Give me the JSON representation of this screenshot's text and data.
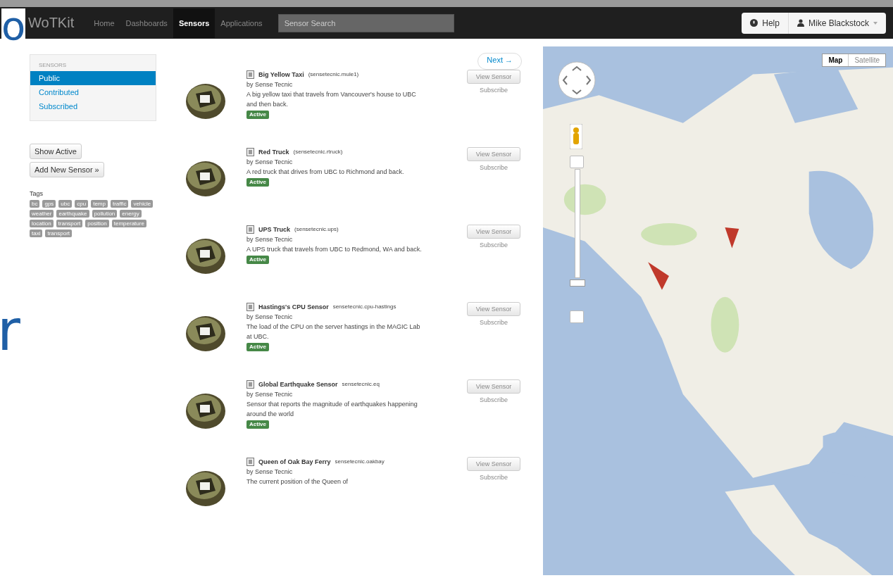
{
  "overlay_letters": [
    "o",
    "r"
  ],
  "navbar": {
    "brand": "WoTKit",
    "links": [
      {
        "label": "Home",
        "selected": false
      },
      {
        "label": "Dashboards",
        "selected": false
      },
      {
        "label": "Sensors",
        "selected": true
      },
      {
        "label": "Applications",
        "selected": false
      }
    ],
    "search": {
      "placeholder": "Sensor Search"
    },
    "help": "Help",
    "user": "Mike Blackstock"
  },
  "sidebar": {
    "heading": "SENSORS",
    "items": [
      {
        "label": "Public",
        "selected": true
      },
      {
        "label": "Contributed",
        "selected": false
      },
      {
        "label": "Subscribed",
        "selected": false
      }
    ],
    "buttons": [
      "Show Active",
      "Add New Sensor »"
    ],
    "tags_label": "Tags",
    "tags": [
      "bc",
      "gps",
      "ubc",
      "cpu",
      "temp",
      "traffic",
      "vehicle",
      "weather",
      "earthquake",
      "pollution",
      "energy",
      "location",
      "transport",
      "position",
      "temperature",
      "taxi",
      "transport"
    ]
  },
  "pager": {
    "next": "Next →"
  },
  "sensors": [
    {
      "title": "Big Yellow Taxi",
      "id": "(sensetecnic.mule1)",
      "byline": "by Sense Tecnic",
      "description": "A big yellow taxi that travels from Vancouver's house to UBC and then back.",
      "active": true,
      "status": "Active",
      "view": "View Sensor",
      "subscribe": "Subscribe"
    },
    {
      "title": "Red Truck",
      "id": "(sensetecnic.rtruck)",
      "byline": "by Sense Tecnic",
      "description": "A red truck that drives from UBC to Richmond and back.",
      "active": true,
      "status": "Active",
      "view": "View Sensor",
      "subscribe": "Subscribe"
    },
    {
      "title": "UPS Truck",
      "id": "(sensetecnic.ups)",
      "byline": "by Sense Tecnic",
      "description": "A UPS truck that travels from UBC to Redmond, WA and back.",
      "active": true,
      "status": "Active",
      "view": "View Sensor",
      "subscribe": "Subscribe"
    },
    {
      "title": "Hastings's CPU Sensor",
      "id": "sensetecnic.cpu-hastings",
      "byline": "by Sense Tecnic",
      "description": "The load of the CPU on the server hastings in the MAGIC Lab at UBC.",
      "active": true,
      "status": "Active",
      "view": "View Sensor",
      "subscribe": "Subscribe"
    },
    {
      "title": "Global Earthquake Sensor",
      "id": "sensetecnic.eq",
      "byline": "by Sense Tecnic",
      "description": "Sensor that reports the magnitude of earthquakes happening around the world",
      "active": true,
      "status": "Active",
      "view": "View Sensor",
      "subscribe": "Subscribe"
    },
    {
      "title": "Queen of Oak Bay Ferry",
      "id": "sensetecnic.oakbay",
      "byline": "by Sense Tecnic",
      "description": "The current position of the Queen of",
      "view": "View Sensor",
      "subscribe": "Subscribe"
    }
  ],
  "map": {
    "types": [
      {
        "label": "Map",
        "selected": true
      },
      {
        "label": "Satellite",
        "selected": false
      }
    ]
  }
}
